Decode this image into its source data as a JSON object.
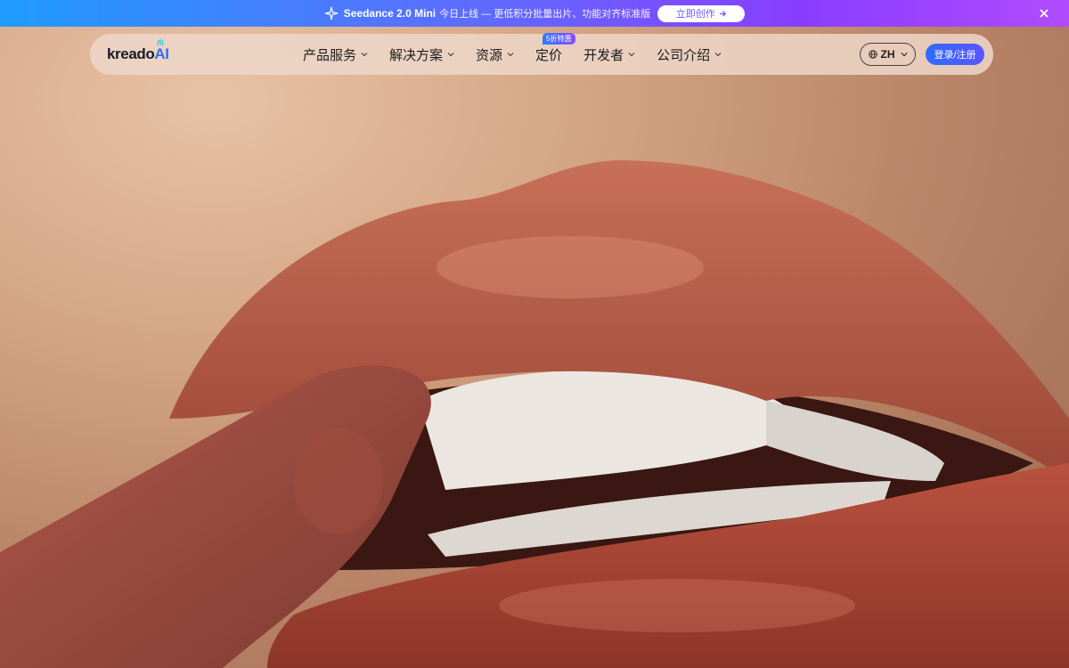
{
  "banner": {
    "product": "Seedance 2.0 Mini",
    "description": "今日上线 — 更低积分批量出片、功能对齐标准版",
    "cta_label": "立即创作",
    "icons": {
      "sparkle": "sparkle-icon",
      "arrow": "arrow-right-icon",
      "close": "close-icon"
    }
  },
  "nav": {
    "logo_text": "kreado",
    "logo_accent": "AI",
    "menu": [
      {
        "label": "产品服务",
        "has_dropdown": true
      },
      {
        "label": "解决方案",
        "has_dropdown": true
      },
      {
        "label": "资源",
        "has_dropdown": true
      },
      {
        "label": "定价",
        "has_dropdown": false,
        "badge": "5折特惠"
      },
      {
        "label": "开发者",
        "has_dropdown": true
      },
      {
        "label": "公司介绍",
        "has_dropdown": true
      }
    ],
    "language": "ZH",
    "login_label": "登录/注册"
  },
  "colors": {
    "banner_start": "#1f9bff",
    "banner_end": "#b04bff",
    "accent": "#2f6bff",
    "nav_bg": "#eed6c8"
  }
}
